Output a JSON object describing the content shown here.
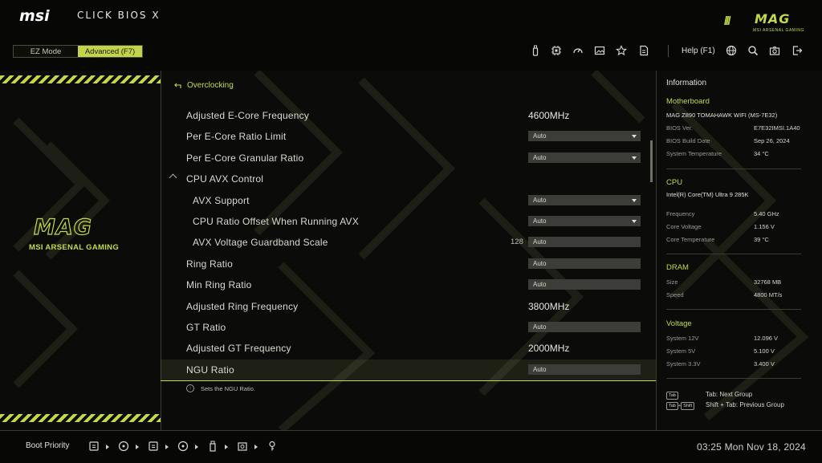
{
  "brand": {
    "logo": "msi",
    "title": "CLICK BIOS X"
  },
  "mag_logo": {
    "word": "MAG",
    "sub": "MSI ARSENAL GAMING"
  },
  "modes": {
    "ez": "EZ Mode",
    "advanced": "Advanced (F7)",
    "active": "advanced"
  },
  "toolbar_icons": [
    "usb-icon",
    "cpu-icon",
    "gauge-icon",
    "image-icon",
    "star-icon",
    "document-icon"
  ],
  "help_label": "Help (F1)",
  "right_icons": [
    "globe-icon",
    "search-icon",
    "camera-icon",
    "exit-icon"
  ],
  "breadcrumb": {
    "label": "Overclocking"
  },
  "settings": [
    {
      "label": "Adjusted E-Core Frequency",
      "type": "text",
      "value": "4600MHz",
      "indent": 0
    },
    {
      "label": "Per E-Core Ratio Limit",
      "type": "select",
      "value": "Auto",
      "indent": 0
    },
    {
      "label": "Per E-Core Granular Ratio",
      "type": "select",
      "value": "Auto",
      "indent": 0
    },
    {
      "label": "CPU AVX Control",
      "type": "group",
      "value": "",
      "indent": 0,
      "expanded": true
    },
    {
      "label": "AVX Support",
      "type": "select",
      "value": "Auto",
      "indent": 1
    },
    {
      "label": "CPU Ratio Offset When Running AVX",
      "type": "select",
      "value": "Auto",
      "indent": 1
    },
    {
      "label": "AVX Voltage Guardband Scale",
      "type": "input",
      "value": "Auto",
      "indent": 1,
      "number": "128"
    },
    {
      "label": "Ring Ratio",
      "type": "input",
      "value": "Auto",
      "indent": 0
    },
    {
      "label": "Min Ring Ratio",
      "type": "input",
      "value": "Auto",
      "indent": 0
    },
    {
      "label": "Adjusted Ring Frequency",
      "type": "text",
      "value": "3800MHz",
      "indent": 0
    },
    {
      "label": "GT Ratio",
      "type": "input",
      "value": "Auto",
      "indent": 0
    },
    {
      "label": "Adjusted GT Frequency",
      "type": "text",
      "value": "2000MHz",
      "indent": 0
    },
    {
      "label": "NGU Ratio",
      "type": "input",
      "value": "Auto",
      "indent": 0,
      "active": true
    }
  ],
  "hint": "Sets the NGU Ratio.",
  "info": {
    "title": "Information",
    "motherboard": {
      "heading": "Motherboard",
      "model": "MAG Z890 TOMAHAWK WIFI (MS-7E32)",
      "rows": [
        {
          "k": "BIOS Ver.",
          "v": "E7E32IMSI.1A40"
        },
        {
          "k": "BIOS Build Date",
          "v": "Sep 26, 2024"
        },
        {
          "k": "System Temperature",
          "v": "34 °C"
        }
      ]
    },
    "cpu": {
      "heading": "CPU",
      "model": "Intel(R) Core(TM) Ultra 9 285K",
      "rows": [
        {
          "k": "Frequency",
          "v": "5.40 GHz"
        },
        {
          "k": "Core Voltage",
          "v": "1.156 V"
        },
        {
          "k": "Core Temperature",
          "v": "39 °C"
        }
      ]
    },
    "dram": {
      "heading": "DRAM",
      "rows": [
        {
          "k": "Size",
          "v": "32768 MB"
        },
        {
          "k": "Speed",
          "v": "4800 MT/s"
        }
      ]
    },
    "voltage": {
      "heading": "Voltage",
      "rows": [
        {
          "k": "System 12V",
          "v": "12.096 V"
        },
        {
          "k": "System 5V",
          "v": "5.100 V"
        },
        {
          "k": "System 3.3V",
          "v": "3.400 V"
        }
      ]
    },
    "keys": [
      {
        "keys": [
          "Tab"
        ],
        "text": "Tab: Next Group"
      },
      {
        "keys": [
          "Tab",
          "+",
          "Shift"
        ],
        "text": "Shift + Tab: Previous Group"
      }
    ]
  },
  "boot": {
    "label": "Boot Priority",
    "devices": [
      "usb-drive-icon",
      "disc-icon",
      "usb-drive-icon",
      "disc-icon",
      "usb-stick-icon",
      "hdd-icon",
      "usb-key-icon"
    ]
  },
  "clock": "03:25  Mon Nov 18, 2024",
  "colors": {
    "accent": "#c6d84a",
    "background": "#0b0c09"
  }
}
